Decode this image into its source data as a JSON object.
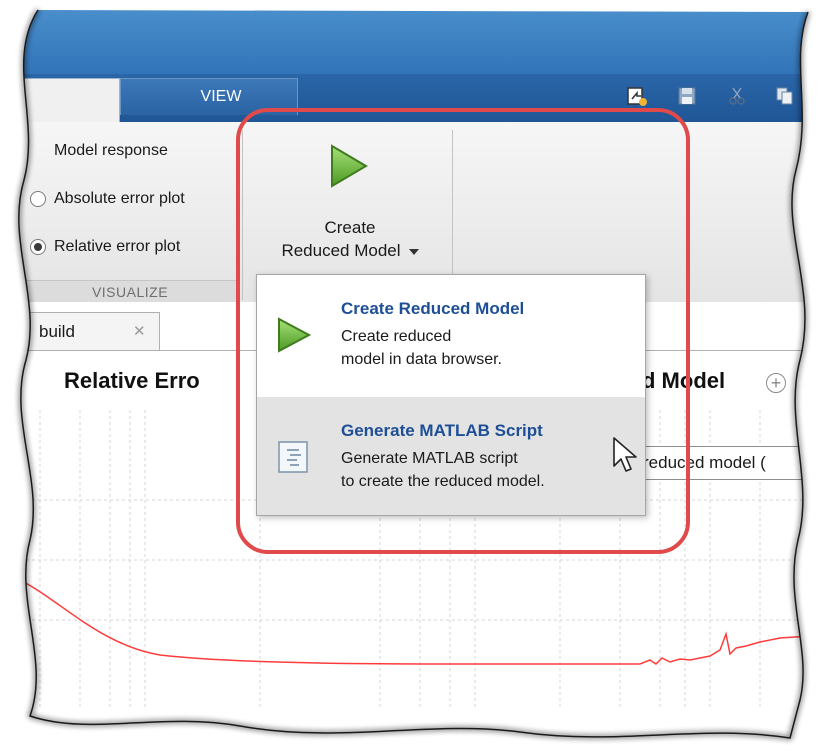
{
  "toolbar": {
    "tabs": [
      {
        "label": "VIEW",
        "active": false
      }
    ],
    "quick_access": [
      "open-icon",
      "save-icon",
      "cut-icon",
      "copy-icon"
    ]
  },
  "ribbon": {
    "visualize": {
      "options": [
        {
          "label": "Model response",
          "checked": false
        },
        {
          "label": "Absolute error plot",
          "checked": false
        },
        {
          "label": "Relative error plot",
          "checked": true
        }
      ],
      "group_label": "VISUALIZE"
    },
    "create_button": {
      "line1": "Create",
      "line2": "Reduced Model"
    }
  },
  "menu": {
    "items": [
      {
        "title": "Create Reduced Model",
        "desc_line1": "Create reduced",
        "desc_line2": "model in data browser.",
        "icon": "play-icon"
      },
      {
        "title": "Generate MATLAB Script",
        "desc_line1": "Generate MATLAB script",
        "desc_line2": "to create the reduced model.",
        "icon": "script-icon"
      }
    ]
  },
  "document": {
    "tab_label": "build",
    "title_left": "Relative Erro",
    "title_right": "d Model",
    "legend_text": "reduced model ("
  },
  "colors": {
    "ribbon_blue": "#2a66a8",
    "highlight_red": "#e04a4a",
    "menu_title": "#1e4f96",
    "plot_line": "#ff3b3b"
  }
}
